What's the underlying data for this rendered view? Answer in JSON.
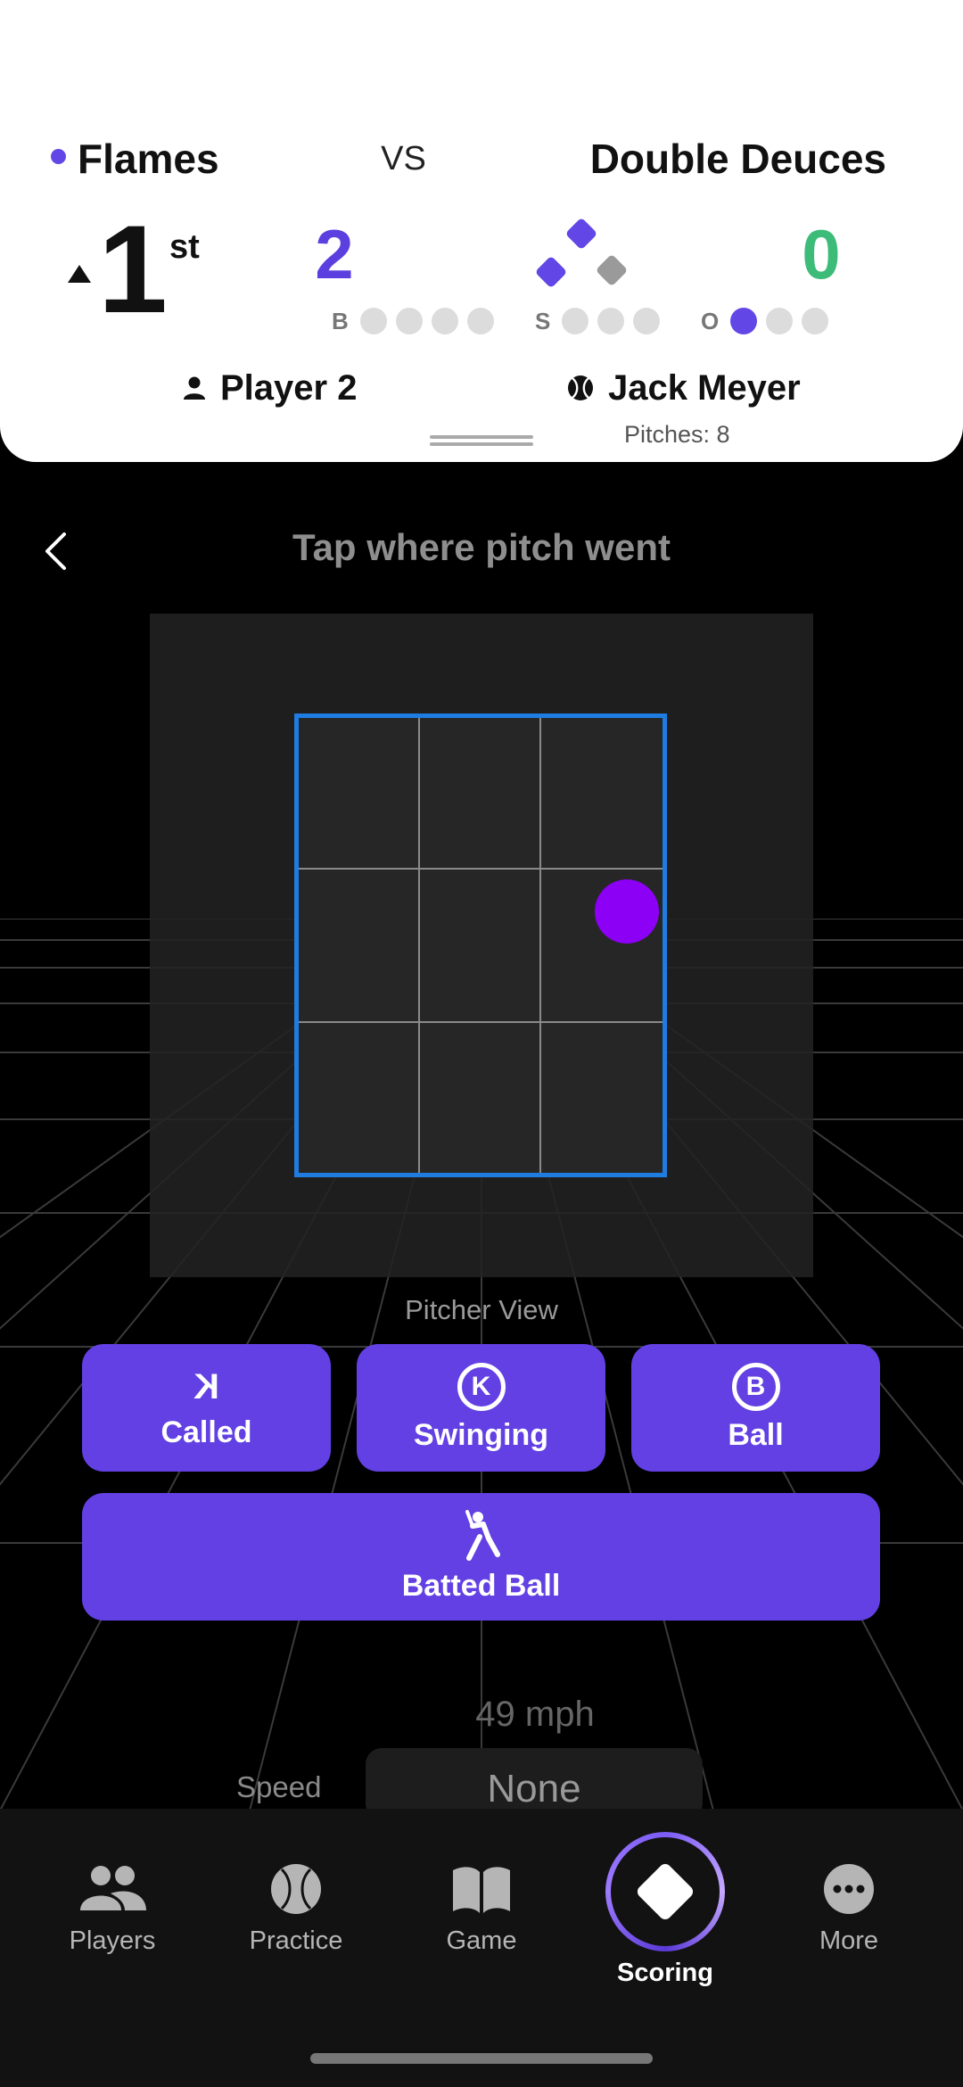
{
  "scoreboard": {
    "home_team": "Flames",
    "vs": "VS",
    "away_team": "Double Deuces",
    "inning": "1",
    "inning_suffix": "st",
    "inning_half": "top",
    "home_score": "2",
    "away_score": "0",
    "count": {
      "balls_label": "B",
      "balls": 0,
      "balls_max": 4,
      "strikes_label": "S",
      "strikes": 0,
      "strikes_max": 3,
      "outs_label": "O",
      "outs": 1,
      "outs_max": 3
    },
    "bases": {
      "first": true,
      "second": true,
      "third": true
    },
    "batter": "Player 2",
    "pitcher": "Jack Meyer",
    "pitches": "Pitches: 8"
  },
  "main": {
    "title": "Tap where pitch went",
    "view_label": "Pitcher View",
    "speed_value": "49 mph",
    "speed_label": "Speed",
    "speed_selected": "None"
  },
  "actions": {
    "called": "Called",
    "called_icon": "K",
    "swinging": "Swinging",
    "swinging_icon": "K",
    "ball": "Ball",
    "ball_icon": "B",
    "batted": "Batted Ball"
  },
  "tabs": [
    {
      "label": "Players",
      "icon": "players-icon"
    },
    {
      "label": "Practice",
      "icon": "baseball-icon"
    },
    {
      "label": "Game",
      "icon": "book-icon"
    },
    {
      "label": "Scoring",
      "icon": "diamond-icon",
      "active": true
    },
    {
      "label": "More",
      "icon": "more-icon"
    }
  ],
  "colors": {
    "accent": "#6240e3",
    "team_dot": "#6247e6",
    "home_score": "#5b3fdf",
    "away_score": "#3dbb78",
    "base_occupied": "#6247e6",
    "base_empty": "#9a9a9a",
    "zone_border": "#1f7ce0",
    "pitch_marker": "#8c00f5"
  }
}
